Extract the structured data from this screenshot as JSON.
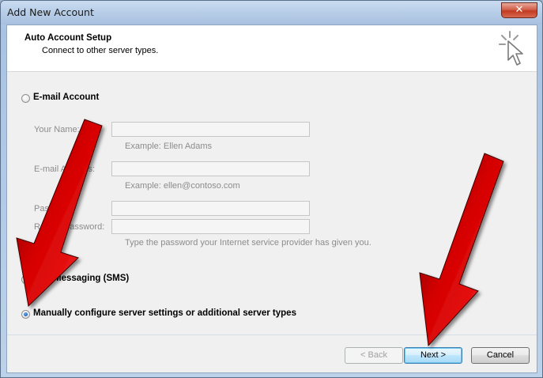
{
  "window": {
    "title": "Add New Account",
    "close_label": "✕"
  },
  "header": {
    "title": "Auto Account Setup",
    "subtitle": "Connect to other server types."
  },
  "email_account": {
    "label": "E-mail Account",
    "your_name_label": "Your Name:",
    "your_name_value": "",
    "your_name_hint": "Example: Ellen Adams",
    "email_label": "E-mail Address:",
    "email_value": "",
    "email_hint": "Example: ellen@contoso.com",
    "password_label": "Password:",
    "password_value": "",
    "retype_label": "Retype Password:",
    "retype_value": "",
    "password_hint": "Type the password your Internet service provider has given you."
  },
  "sms": {
    "label": "Text Messaging (SMS)"
  },
  "manual": {
    "label": "Manually configure server settings or additional server types",
    "selected": true
  },
  "buttons": {
    "back": "< Back",
    "next": "Next >",
    "cancel": "Cancel"
  },
  "colors": {
    "arrow": "#d40000",
    "accent": "#3c7fb1"
  }
}
